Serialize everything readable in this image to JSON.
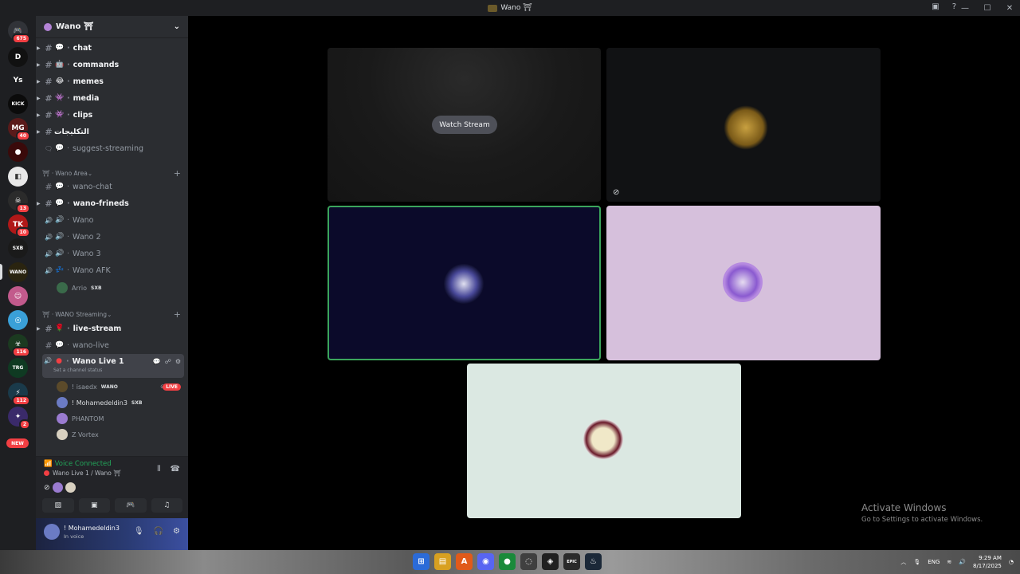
{
  "window": {
    "title": "Wano ⛩",
    "controls": [
      "—",
      "☐",
      "✕"
    ],
    "extra_icons": [
      "inbox-icon",
      "help-icon"
    ]
  },
  "guilds": [
    {
      "label": "🎮",
      "color": "#313338",
      "badge": "675",
      "icon": "discord-home-icon"
    },
    {
      "label": "D",
      "color": "#111111",
      "badge": "",
      "icon": "server-d"
    },
    {
      "label": "Ys",
      "color": "#1e1f22",
      "badge": "",
      "icon": "server-ys"
    },
    {
      "label": "KICK",
      "color": "#0b0b0b",
      "badge": "",
      "icon": "server-kick"
    },
    {
      "label": "MG",
      "color": "#5a1a1a",
      "badge": "40",
      "icon": "server-mg"
    },
    {
      "label": "●",
      "color": "#3a0a0a",
      "badge": "",
      "icon": "server-red"
    },
    {
      "label": "◧",
      "color": "#e8e8e8",
      "badge": "",
      "icon": "server-white"
    },
    {
      "label": "☠",
      "color": "#2b2b2b",
      "badge": "13",
      "icon": "server-skull"
    },
    {
      "label": "TK",
      "color": "#b01818",
      "badge": "10",
      "icon": "server-tk"
    },
    {
      "label": "SXB",
      "color": "#1a1a1a",
      "badge": "",
      "icon": "server-sxb"
    },
    {
      "label": "WANO",
      "color": "#2a2410",
      "badge": "",
      "icon": "server-wano"
    },
    {
      "label": "☺",
      "color": "#c25a8c",
      "badge": "",
      "icon": "server-kirby"
    },
    {
      "label": "◎",
      "color": "#3aa0d8",
      "badge": "",
      "icon": "server-blue"
    },
    {
      "label": "☣",
      "color": "#1b3a20",
      "badge": "116",
      "icon": "server-green"
    },
    {
      "label": "TRG",
      "color": "#0f3a22",
      "badge": "",
      "icon": "server-trg"
    },
    {
      "label": "⚡",
      "color": "#1a3a4a",
      "badge": "112",
      "icon": "server-teal"
    },
    {
      "label": "✦",
      "color": "#3a2a6a",
      "badge": "2",
      "icon": "server-purple"
    }
  ],
  "new_badge": "NEW",
  "server": {
    "name": "Wano ⛩"
  },
  "channels": [
    {
      "type": "text",
      "emoji": "💬",
      "name": "chat",
      "unread": true,
      "arrow": true
    },
    {
      "type": "text",
      "emoji": "🤖",
      "name": "commands",
      "unread": true,
      "arrow": true
    },
    {
      "type": "text",
      "emoji": "😂",
      "name": "memes",
      "unread": true,
      "arrow": true
    },
    {
      "type": "text",
      "emoji": "👾",
      "name": "media",
      "unread": true,
      "arrow": true
    },
    {
      "type": "text",
      "emoji": "👾",
      "name": "clips",
      "unread": true,
      "arrow": true
    },
    {
      "type": "text",
      "emoji": "",
      "name": "التكليجات",
      "unread": true,
      "arrow": true,
      "nodot": true
    },
    {
      "type": "forum",
      "emoji": "💬",
      "name": "suggest-streaming",
      "unread": false,
      "arrow": false
    }
  ],
  "category_area": "Wano Area",
  "area_channels": [
    {
      "type": "text",
      "emoji": "💬",
      "name": "wano-chat",
      "unread": false,
      "arrow": false
    },
    {
      "type": "text",
      "emoji": "💬",
      "name": "wano-frineds",
      "unread": true,
      "arrow": true
    },
    {
      "type": "voice",
      "emoji": "🔊",
      "name": "Wano",
      "unread": false
    },
    {
      "type": "voice",
      "emoji": "🔊",
      "name": "Wano 2",
      "unread": false
    },
    {
      "type": "voice",
      "emoji": "🔊",
      "name": "Wano 3",
      "unread": false
    },
    {
      "type": "voice",
      "emoji": "💤",
      "name": "Wano AFK",
      "unread": false
    }
  ],
  "afk_user": {
    "name": "Arrio",
    "tag": "SXB"
  },
  "category_streaming": "WANO Streaming",
  "streaming_channels": [
    {
      "type": "text",
      "emoji": "🌹",
      "name": "live-stream",
      "unread": true,
      "arrow": true
    },
    {
      "type": "text",
      "emoji": "💬",
      "name": "wano-live",
      "unread": false,
      "arrow": false
    }
  ],
  "active_channel": {
    "name": "Wano Live 1",
    "status": "Set a channel status"
  },
  "voice_users": [
    {
      "name": "! isaedx",
      "tag": "WANO",
      "live": "LIVE",
      "color": "#5b4a2a",
      "bright": false
    },
    {
      "name": "! Mohamedeldin3",
      "tag": "SXB",
      "live": "",
      "color": "#6b7bc4",
      "bright": true
    },
    {
      "name": "PHANTOM",
      "tag": "",
      "live": "",
      "color": "#9a7bd0",
      "bright": false
    },
    {
      "name": "Z Vortex",
      "tag": "",
      "live": "",
      "color": "#d8d0c0",
      "bright": false
    }
  ],
  "voice_panel": {
    "title": "Voice Connected",
    "sub": "Wano Live 1 / Wano ⛩"
  },
  "user_panel": {
    "name": "! Mohamedeldin3",
    "status": "In voice"
  },
  "stage": {
    "watch_stream": "Watch Stream"
  },
  "activate": {
    "title": "Activate Windows",
    "subtitle": "Go to Settings to activate Windows."
  },
  "taskbar": {
    "lang": "ENG",
    "time": "9:29 AM",
    "date": "8/17/2025",
    "apps": [
      {
        "label": "⊞",
        "color": "#2b6bd8"
      },
      {
        "label": "▤",
        "color": "#d8a020"
      },
      {
        "label": "A",
        "color": "#e05a1a"
      },
      {
        "label": "◉",
        "color": "#5865f2"
      },
      {
        "label": "●",
        "color": "#1a8a3a"
      },
      {
        "label": "◌",
        "color": "#404040"
      },
      {
        "label": "◈",
        "color": "#202020"
      },
      {
        "label": "EPIC",
        "color": "#2a2a2a"
      },
      {
        "label": "♨",
        "color": "#1b2838"
      }
    ]
  }
}
